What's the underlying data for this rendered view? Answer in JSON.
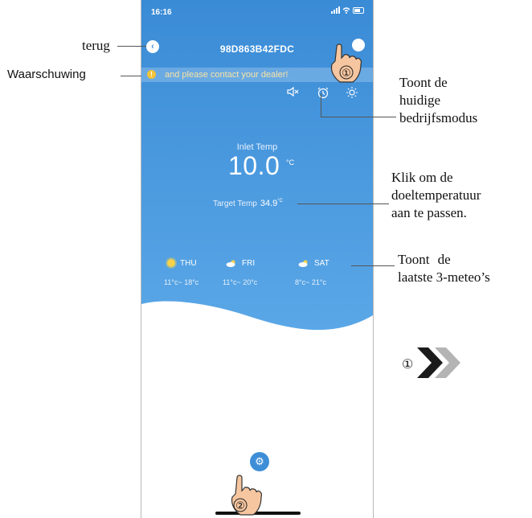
{
  "status_bar": {
    "time": "16:16"
  },
  "header": {
    "title": "98D863B42FDC"
  },
  "warning": {
    "text": "and please contact your dealer!"
  },
  "inlet": {
    "label": "Inlet Temp",
    "value": "10.0",
    "unit": "°C"
  },
  "target": {
    "label": "Target Temp",
    "value": "34.9",
    "unit": "°C"
  },
  "forecast": [
    {
      "day": "THU",
      "range": "11°c~ 18°c",
      "icon": "sun-icon"
    },
    {
      "day": "FRI",
      "range": "11°c~ 20°c",
      "icon": "partly-cloudy-icon"
    },
    {
      "day": "SAT",
      "range": "8°c~ 21°c",
      "icon": "partly-cloudy-icon"
    }
  ],
  "annotations": {
    "back": "terug",
    "warning": "Waarschuwing",
    "mode": [
      "Toont de",
      "huidige",
      "bedrijfsmodus"
    ],
    "target": [
      "Klik om de",
      "doeltemperatuur",
      "aan te passen."
    ],
    "weather_1a": "Toont",
    "weather_1b": "de",
    "weather_2a": "laatste",
    "weather_2b": "3-meteo’s",
    "marker_1": "①",
    "marker_2": "②"
  },
  "colors": {
    "sky_top": "#3d8ed7",
    "sky_bottom": "#5aa6e6",
    "warning": "#f3c33a"
  }
}
